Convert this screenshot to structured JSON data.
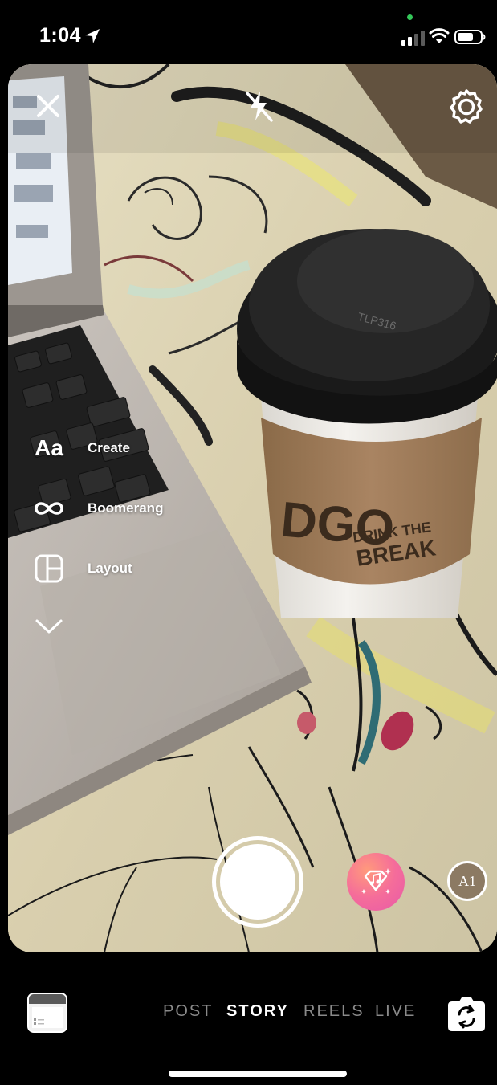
{
  "status_bar": {
    "time": "1:04",
    "icons": [
      "location-arrow-icon",
      "signal-icon",
      "wifi-icon",
      "battery-icon"
    ],
    "privacy_dot_color": "#34c759"
  },
  "top_controls": {
    "close": "close-icon",
    "flash": "flash-off-icon",
    "settings": "settings-gear-icon"
  },
  "tools": [
    {
      "icon_text": "Aa",
      "label": "Create"
    },
    {
      "icon": "infinity-icon",
      "label": "Boomerang"
    },
    {
      "icon": "layout-icon",
      "label": "Layout"
    },
    {
      "icon": "chevron-down-icon"
    }
  ],
  "effects": {
    "music_effect_icon": "music-note-sparkle-icon",
    "ai_effect_label": "A1"
  },
  "mode_tabs": [
    "POST",
    "STORY",
    "REELS",
    "LIVE"
  ],
  "active_mode": "STORY",
  "colors": {
    "active_tab": "#ffffff",
    "inactive_tab": "#8a8a8a",
    "music_effect_gradient": [
      "#ff9a7c",
      "#e85aa8"
    ]
  }
}
